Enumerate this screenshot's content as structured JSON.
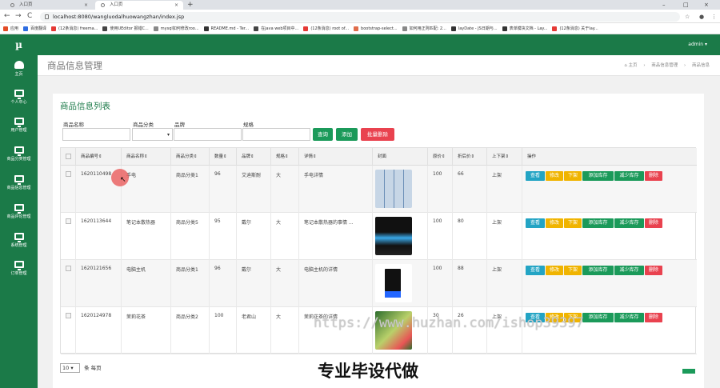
{
  "browser": {
    "tabs": [
      {
        "label": "入口页",
        "close": "×"
      },
      {
        "label": "入口页",
        "close": "×"
      }
    ],
    "new_tab": "+",
    "window_controls": [
      "–",
      "□",
      "×"
    ],
    "nav": {
      "back": "←",
      "forward": "→",
      "reload": "C"
    },
    "url": "localhost:8080/wangluodalhuowangzhan/index.jsp",
    "ext_icons": [
      "☆",
      "●",
      "⋮"
    ],
    "bookmarks": [
      {
        "label": "应用",
        "color": "#e34c26"
      },
      {
        "label": "百度翻译",
        "color": "#2f6de1"
      },
      {
        "label": "(12条消息) freema...",
        "color": "#e53935"
      },
      {
        "label": "使用UEditor 报错C...",
        "color": "#444444"
      },
      {
        "label": "mysql如何修改roo...",
        "color": "#888888"
      },
      {
        "label": "README.md - Ter...",
        "color": "#333333"
      },
      {
        "label": "在java web项目中...",
        "color": "#444444"
      },
      {
        "label": "(12条消息) root of...",
        "color": "#e53935"
      },
      {
        "label": "bootstrap-select...",
        "color": "#e06c4a"
      },
      {
        "label": "如何用正则匹配: 2...",
        "color": "#888888"
      },
      {
        "label": "layDate - JS日期与...",
        "color": "#333333"
      },
      {
        "label": "表单模块文档 - Lay...",
        "color": "#333333"
      },
      {
        "label": "(12条消息) 关于lay...",
        "color": "#e53935"
      }
    ]
  },
  "sidebar": {
    "logo": "µ",
    "items": [
      {
        "label": "主页",
        "icon": "dashboard-icon"
      },
      {
        "label": "个人中心",
        "icon": "monitor-icon"
      },
      {
        "label": "用户管理",
        "icon": "monitor-icon"
      },
      {
        "label": "商品分类管理",
        "icon": "monitor-icon"
      },
      {
        "label": "商品信息管理",
        "icon": "monitor-icon"
      },
      {
        "label": "商品评论管理",
        "icon": "monitor-icon"
      },
      {
        "label": "系统管理",
        "icon": "monitor-icon"
      },
      {
        "label": "订单管理",
        "icon": "monitor-icon"
      }
    ]
  },
  "topbar": {
    "user": "admin ▾"
  },
  "page": {
    "title": "商品信息管理",
    "breadcrumb": [
      "⌂ 主页",
      "›",
      "商品信息管理",
      "›",
      "商品信息"
    ]
  },
  "panel": {
    "title": "商品信息列表",
    "filters": {
      "name_label": "商品名称",
      "category_label": "商品分类",
      "brand_label": "品牌",
      "spec_label": "规格",
      "select_caret": "▾"
    },
    "buttons": {
      "search": "查询",
      "add": "添加",
      "batch_delete": "批量删除"
    },
    "columns": [
      "商品编号⇕",
      "商品名称⇕",
      "商品分类⇕",
      "数量⇕",
      "品牌⇕",
      "规格⇕",
      "详情⇕",
      "封面",
      "原价⇕",
      "折后价⇕",
      "上下架⇕",
      "操作"
    ],
    "rows": [
      {
        "id": "1620110498",
        "name": "手电",
        "category": "商品分类1",
        "qty": "96",
        "brand": "艾迪斯耐",
        "spec": "大",
        "detail": "手电详情",
        "orig": "100",
        "discount": "66",
        "status": "上架",
        "thumb": "thumb1"
      },
      {
        "id": "1620113644",
        "name": "笔记本散热器",
        "category": "商品分类5",
        "qty": "95",
        "brand": "戴尔",
        "spec": "大",
        "detail": "笔记本散热器的事情 ...",
        "orig": "100",
        "discount": "80",
        "status": "上架",
        "thumb": "thumb2"
      },
      {
        "id": "1620121656",
        "name": "电脑主机",
        "category": "商品分类1",
        "qty": "96",
        "brand": "戴尔",
        "spec": "大",
        "detail": "电脑主机的详情",
        "orig": "100",
        "discount": "88",
        "status": "上架",
        "thumb": "thumb3"
      },
      {
        "id": "1620124978",
        "name": "茉莉花茶",
        "category": "商品分类2",
        "qty": "100",
        "brand": "老君山",
        "spec": "大",
        "detail": "茉莉花茶的详情",
        "orig": "30",
        "discount": "26",
        "status": "上架",
        "thumb": "thumb4"
      }
    ],
    "actions": [
      {
        "label": "查看",
        "color": "#23a4c4"
      },
      {
        "label": "修改",
        "color": "#f0b400"
      },
      {
        "label": "下架",
        "color": "#f0b400"
      },
      {
        "label": "添加库存",
        "color": "#1b9a5a"
      },
      {
        "label": "减少库存",
        "color": "#1b9a5a"
      },
      {
        "label": "删除",
        "color": "#e9424f"
      }
    ],
    "pager": {
      "page_size": "10",
      "caret": "▾",
      "suffix": "条 每页"
    }
  },
  "overlays": {
    "watermark": "https://www.huzhan.com/ishop39397",
    "caption": "专业毕设代做"
  },
  "colors": {
    "brand_green": "#1b7a48",
    "info": "#23a4c4",
    "warning": "#f0b400",
    "success": "#1b9a5a",
    "danger": "#e9424f"
  }
}
